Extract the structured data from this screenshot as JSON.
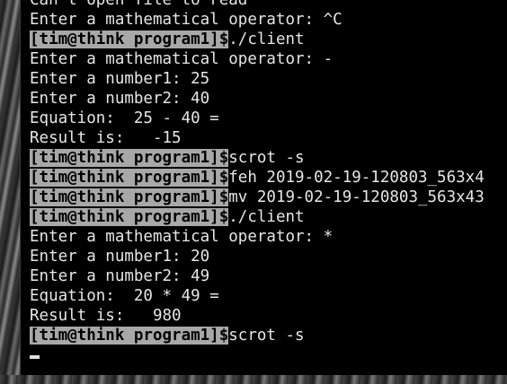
{
  "terminal": {
    "prompt": "[tim@think program1]$",
    "lines": [
      {
        "type": "text",
        "text": "Can't open file to read"
      },
      {
        "type": "text",
        "text": "Enter a mathematical operator: ^C"
      },
      {
        "type": "prompt",
        "text": "./client"
      },
      {
        "type": "text",
        "text": "Enter a mathematical operator: -"
      },
      {
        "type": "text",
        "text": "Enter a number1: 25"
      },
      {
        "type": "text",
        "text": "Enter a number2: 40"
      },
      {
        "type": "text",
        "text": "Equation:  25 - 40 ="
      },
      {
        "type": "text",
        "text": "Result is:   -15"
      },
      {
        "type": "prompt",
        "text": "scrot -s"
      },
      {
        "type": "prompt",
        "text": "feh 2019-02-19-120803_563x4"
      },
      {
        "type": "prompt",
        "text": "mv 2019-02-19-120803_563x43"
      },
      {
        "type": "prompt",
        "text": "./client"
      },
      {
        "type": "text",
        "text": "Enter a mathematical operator: *"
      },
      {
        "type": "text",
        "text": "Enter a number1: 20"
      },
      {
        "type": "text",
        "text": "Enter a number2: 49"
      },
      {
        "type": "text",
        "text": "Equation:  20 * 49 ="
      },
      {
        "type": "text",
        "text": "Result is:   980"
      },
      {
        "type": "prompt",
        "text": "scrot -s"
      }
    ]
  }
}
